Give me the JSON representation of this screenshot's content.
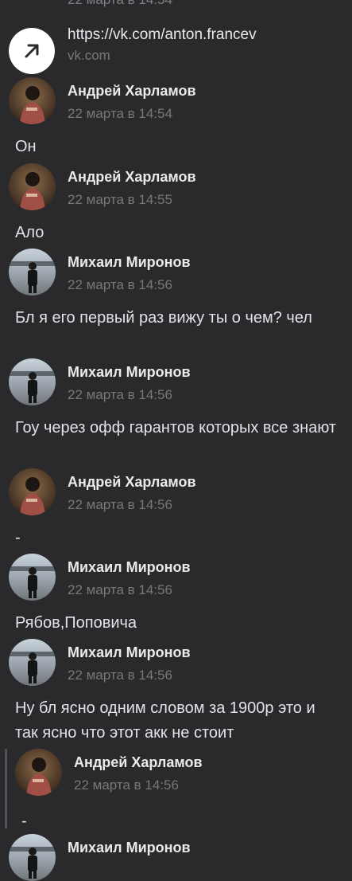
{
  "top_cut_time": "22 марта в 14:54",
  "link": {
    "url": "https://vk.com/anton.francev",
    "domain": "vk.com",
    "icon": "external-link-arrow-icon"
  },
  "messages": [
    {
      "author": "Андрей Харламов",
      "time": "22 марта в 14:54",
      "text": "Он",
      "avatar": "andrey-avatar"
    },
    {
      "author": "Андрей Харламов",
      "time": "22 марта в 14:55",
      "text": "Ало",
      "avatar": "andrey-avatar"
    },
    {
      "author": "Михаил Миронов",
      "time": "22 марта в 14:56",
      "text": "Бл я его первый раз вижу ты о чем? чел",
      "avatar": "mikhail-avatar"
    },
    {
      "author": "Михаил Миронов",
      "time": "22 марта в 14:56",
      "text": "Гоу через офф гарантов которых все знают",
      "avatar": "mikhail-avatar"
    },
    {
      "author": "Андрей Харламов",
      "time": "22 марта в 14:56",
      "text": "-",
      "avatar": "andrey-avatar"
    },
    {
      "author": "Михаил Миронов",
      "time": "22 марта в 14:56",
      "text": "Рябов,Поповича",
      "avatar": "mikhail-avatar"
    },
    {
      "author": "Михаил Миронов",
      "time": "22 марта в 14:56",
      "text": "Ну бл ясно одним словом за 1900р это и так ясно что этот акк не стоит",
      "avatar": "mikhail-avatar"
    },
    {
      "author": "Андрей Харламов",
      "time": "22 марта в 14:56",
      "text": "-",
      "avatar": "andrey-avatar",
      "quoted": true
    },
    {
      "author": "Михаил Миронов",
      "time": "",
      "text": "",
      "avatar": "mikhail-avatar"
    }
  ]
}
